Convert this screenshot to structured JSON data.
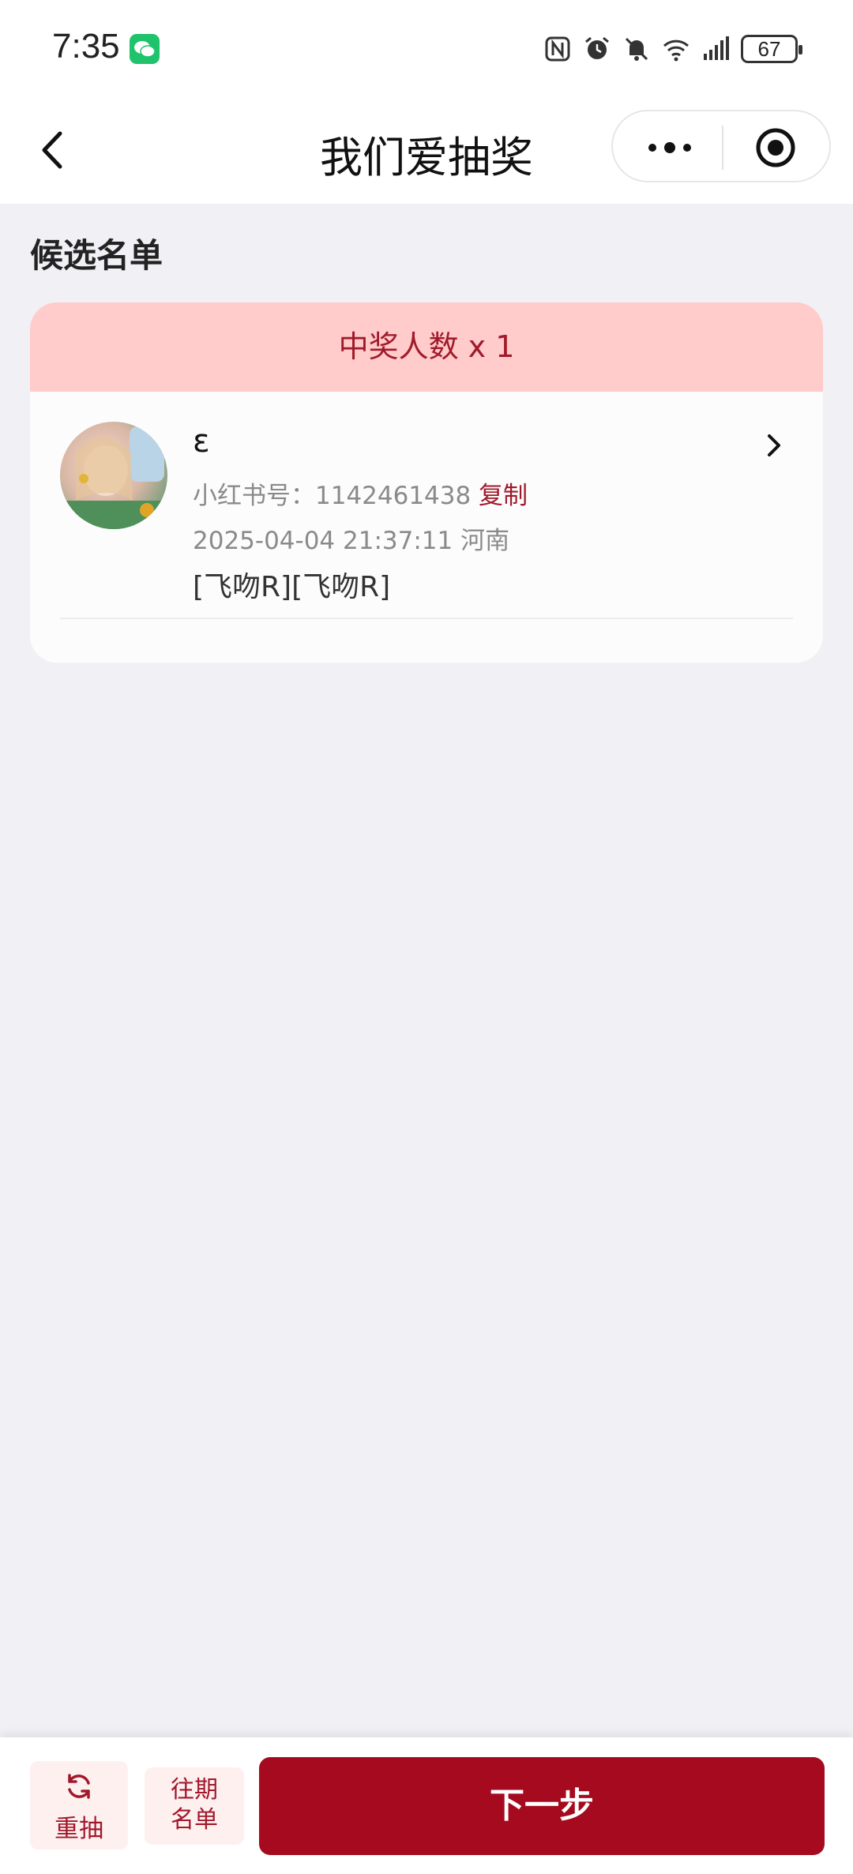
{
  "status_bar": {
    "time": "7:35",
    "battery": "67",
    "icons": [
      "wechat-icon",
      "nfc-icon",
      "alarm-icon",
      "mute-icon",
      "wifi-icon",
      "signal-icon",
      "battery-icon"
    ]
  },
  "nav": {
    "title": "我们爱抽奖",
    "back_icon": "chevron-left-icon",
    "more_icon": "more-dots-icon",
    "close_icon": "target-icon"
  },
  "section": {
    "title": "候选名单"
  },
  "card": {
    "header": "中奖人数 x 1",
    "entries": [
      {
        "name": "ε",
        "id_label": "小红书号：1142461438",
        "copy_label": "复制",
        "time_location": "2025-04-04 21:37:11   河南",
        "comment": "[飞吻R][飞吻R]"
      }
    ]
  },
  "bottom_bar": {
    "redraw_label": "重抽",
    "history_label_line1": "往期",
    "history_label_line2": "名单",
    "next_label": "下一步"
  },
  "colors": {
    "accent": "#a50a1e",
    "header_bg": "#ffcbcb",
    "page_bg": "#f0f0f5"
  }
}
